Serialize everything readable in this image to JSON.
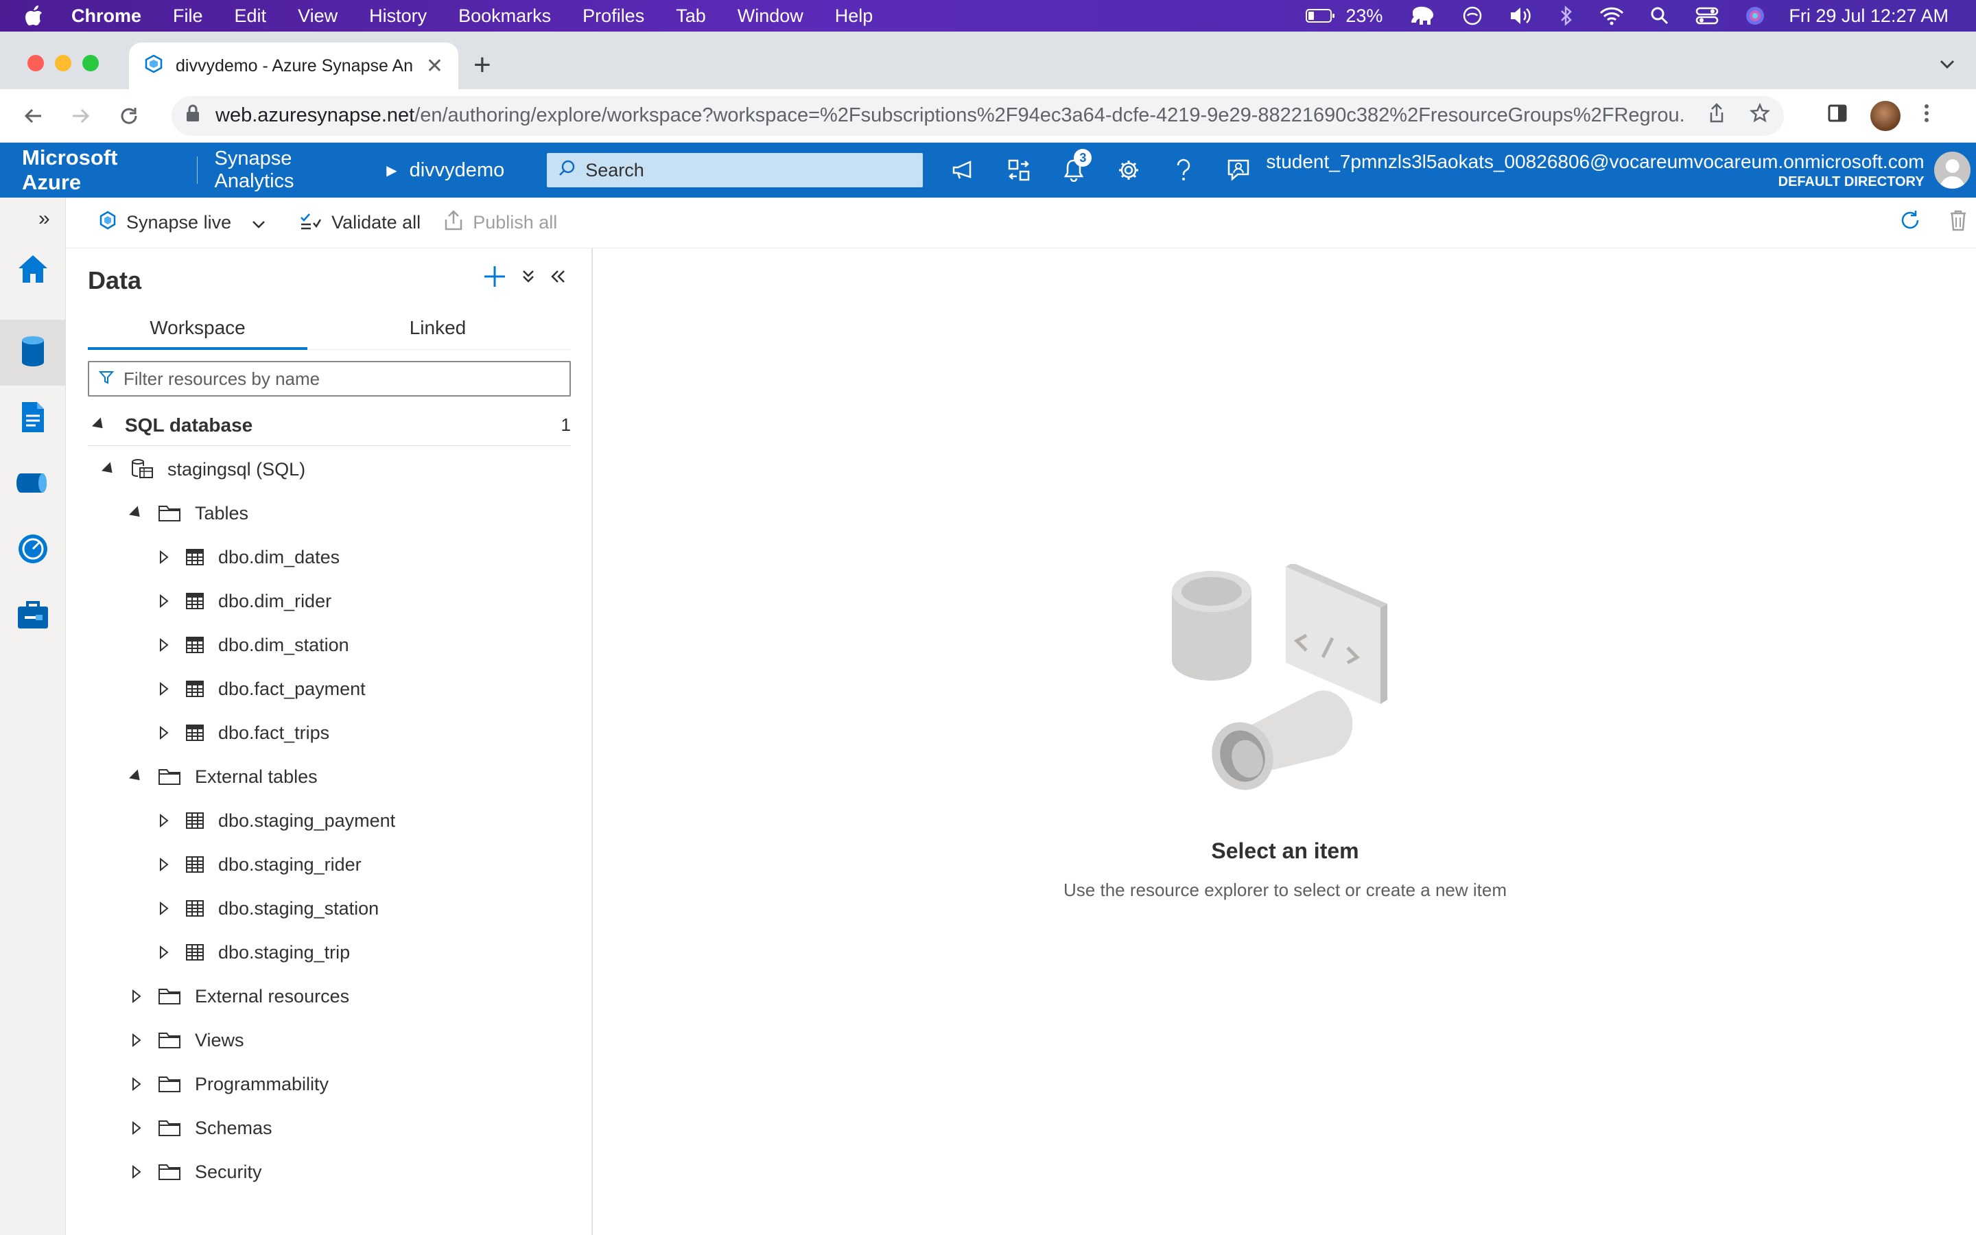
{
  "macos": {
    "app_name": "Chrome",
    "menu": [
      "File",
      "Edit",
      "View",
      "History",
      "Bookmarks",
      "Profiles",
      "Tab",
      "Window",
      "Help"
    ],
    "battery": "23%",
    "datetime": "Fri 29 Jul  12:27 AM"
  },
  "browser": {
    "tab_title": "divvydemo - Azure Synapse An",
    "url_host": "web.azuresynapse.net",
    "url_path": "/en/authoring/explore/workspace?workspace=%2Fsubscriptions%2F94ec3a64-dcfe-4219-9e29-88221690c382%2FresourceGroups%2FRegrou..."
  },
  "azure": {
    "brand": "Microsoft Azure",
    "breadcrumb_service": "Synapse Analytics",
    "breadcrumb_workspace": "divvydemo",
    "search_placeholder": "Search",
    "notification_count": "3",
    "user_email": "student_7pmnzls3l5aokats_00826806@vocareumvocareum.onmicrosoft.com",
    "directory": "DEFAULT DIRECTORY"
  },
  "toolbar": {
    "mode_label": "Synapse live",
    "validate_label": "Validate all",
    "publish_label": "Publish all"
  },
  "data_panel": {
    "title": "Data",
    "tabs": [
      "Workspace",
      "Linked"
    ],
    "filter_placeholder": "Filter resources by name",
    "section_label": "SQL database",
    "section_count": "1",
    "database": "stagingsql (SQL)",
    "tables_folder": "Tables",
    "tables": [
      "dbo.dim_dates",
      "dbo.dim_rider",
      "dbo.dim_station",
      "dbo.fact_payment",
      "dbo.fact_trips"
    ],
    "external_folder": "External tables",
    "external_tables": [
      "dbo.staging_payment",
      "dbo.staging_rider",
      "dbo.staging_station",
      "dbo.staging_trip"
    ],
    "other_folders": [
      "External resources",
      "Views",
      "Programmability",
      "Schemas",
      "Security"
    ]
  },
  "empty_state": {
    "heading": "Select an item",
    "subtext": "Use the resource explorer to select or create a new item"
  },
  "colors": {
    "azure_blue": "#0e6cc4",
    "accent": "#0078d4",
    "mac_bar": "#4c1d95"
  }
}
